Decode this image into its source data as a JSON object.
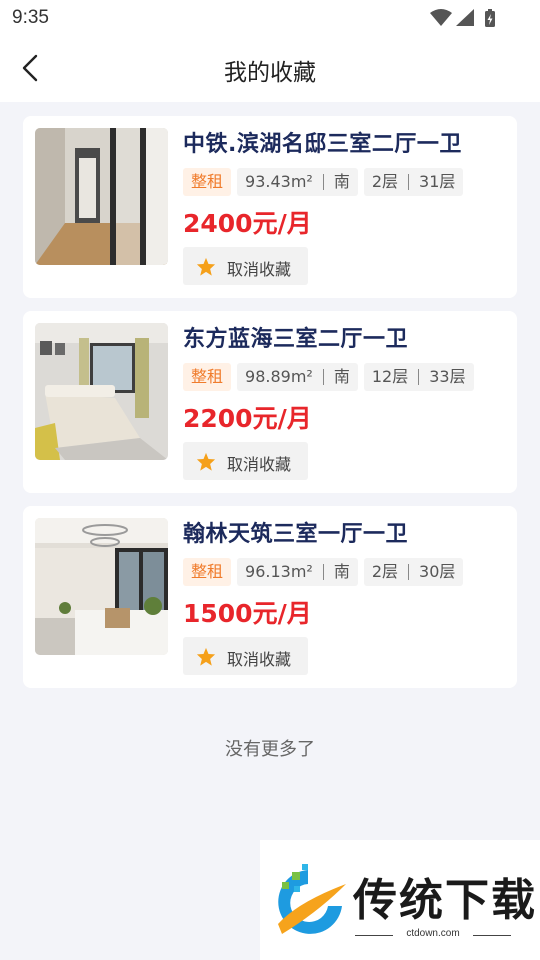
{
  "status_bar": {
    "time": "9:35"
  },
  "header": {
    "title": "我的收藏"
  },
  "listings": [
    {
      "title": "中铁.滨湖名邸三室二厅一卫",
      "rent_type": "整租",
      "area": "93.43m²",
      "orientation": "南",
      "floor": "2层",
      "total_floors": "31层",
      "price": "2400元/月",
      "unfavorite_label": "取消收藏"
    },
    {
      "title": "东方蓝海三室二厅一卫",
      "rent_type": "整租",
      "area": "98.89m²",
      "orientation": "南",
      "floor": "12层",
      "total_floors": "33层",
      "price": "2200元/月",
      "unfavorite_label": "取消收藏"
    },
    {
      "title": "翰林天筑三室一厅一卫",
      "rent_type": "整租",
      "area": "96.13m²",
      "orientation": "南",
      "floor": "2层",
      "total_floors": "30层",
      "price": "1500元/月",
      "unfavorite_label": "取消收藏"
    }
  ],
  "footer": {
    "no_more": "没有更多了"
  },
  "watermark": {
    "brand": "传统下载",
    "url": "ctdown.com"
  },
  "colors": {
    "accent_price": "#e8262b",
    "title_navy": "#1c2a5c",
    "tag_orange": "#f07c2c",
    "star": "#f5a01a"
  }
}
